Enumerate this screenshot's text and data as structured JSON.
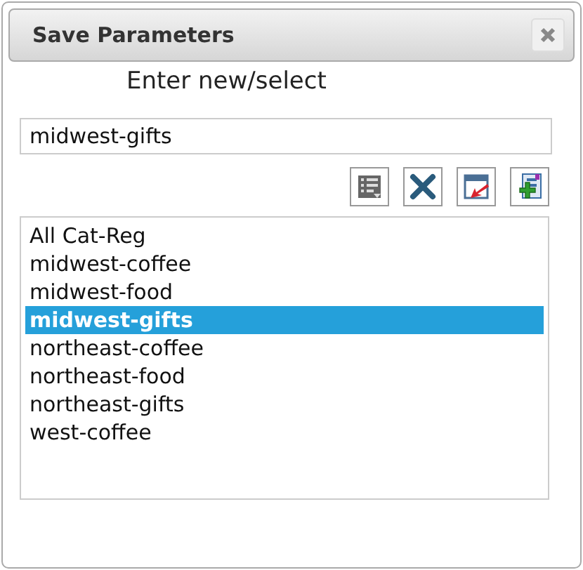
{
  "window": {
    "title": "Save Parameters"
  },
  "prompt": "Enter new/select",
  "name_field": {
    "value": "midwest-gifts"
  },
  "toolbar": [
    {
      "kind": "list"
    },
    {
      "kind": "delete"
    },
    {
      "kind": "load"
    },
    {
      "kind": "add"
    }
  ],
  "list": [
    {
      "label": "All Cat-Reg",
      "selected": false
    },
    {
      "label": "midwest-coffee",
      "selected": false
    },
    {
      "label": "midwest-food",
      "selected": false
    },
    {
      "label": "midwest-gifts",
      "selected": true
    },
    {
      "label": "northeast-coffee",
      "selected": false
    },
    {
      "label": "northeast-food",
      "selected": false
    },
    {
      "label": "northeast-gifts",
      "selected": false
    },
    {
      "label": "west-coffee",
      "selected": false
    }
  ]
}
